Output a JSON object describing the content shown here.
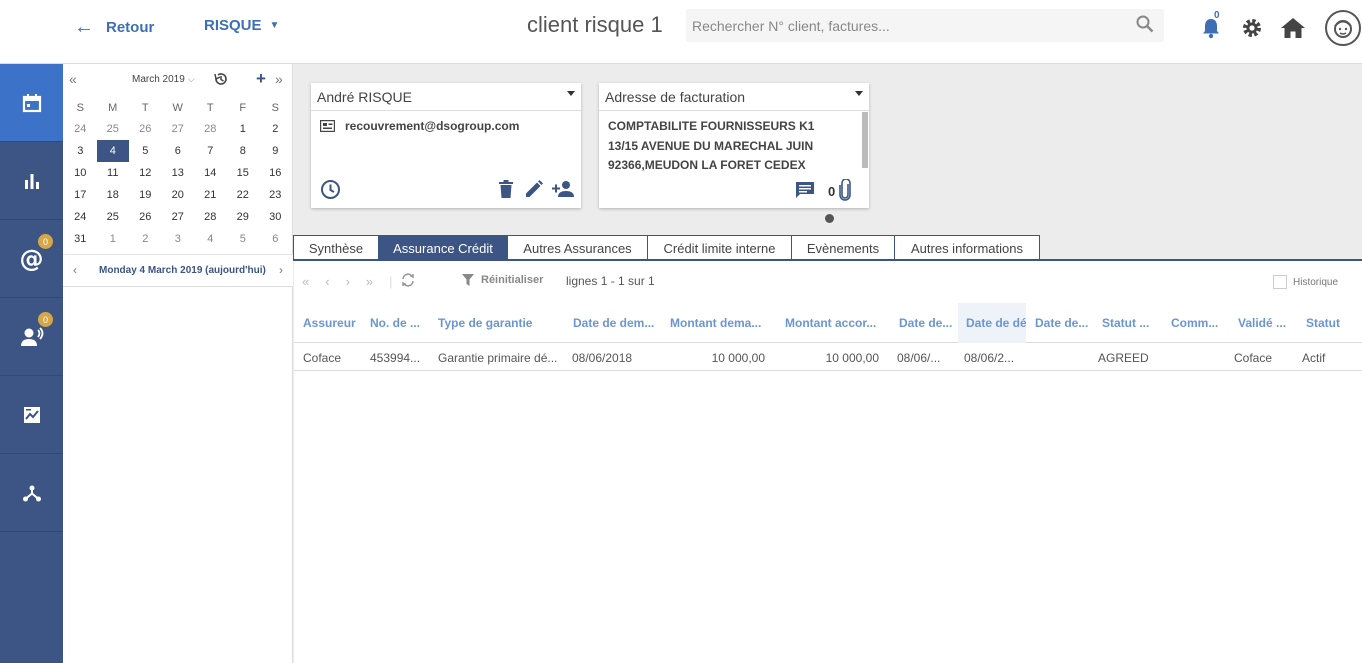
{
  "header": {
    "back_label": "Retour",
    "risk_label": "RISQUE",
    "title": "client risque 1",
    "search_placeholder": "Rechercher N° client, factures...",
    "notifications_count": "0"
  },
  "sidebar": {
    "items": [
      {
        "icon": "calendar-icon",
        "badge": ""
      },
      {
        "icon": "bar-chart-icon",
        "badge": ""
      },
      {
        "icon": "at-icon",
        "badge": "0"
      },
      {
        "icon": "contacts-icon",
        "badge": "0"
      },
      {
        "icon": "report-icon",
        "badge": ""
      },
      {
        "icon": "network-icon",
        "badge": ""
      }
    ]
  },
  "calendar": {
    "month_label": "March 2019",
    "weekdays": [
      "S",
      "M",
      "T",
      "W",
      "T",
      "F",
      "S"
    ],
    "weeks": [
      [
        "24",
        "25",
        "26",
        "27",
        "28",
        "1",
        "2"
      ],
      [
        "3",
        "4",
        "5",
        "6",
        "7",
        "8",
        "9"
      ],
      [
        "10",
        "11",
        "12",
        "13",
        "14",
        "15",
        "16"
      ],
      [
        "17",
        "18",
        "19",
        "20",
        "21",
        "22",
        "23"
      ],
      [
        "24",
        "25",
        "26",
        "27",
        "28",
        "29",
        "30"
      ],
      [
        "31",
        "1",
        "2",
        "3",
        "4",
        "5",
        "6"
      ]
    ],
    "today_label": "Monday 4 March 2019 (aujourd'hui)"
  },
  "contact_card": {
    "name": "André RISQUE",
    "email": "recouvrement@dsogroup.com"
  },
  "address_card": {
    "type": "Adresse de facturation",
    "line1": "COMPTABILITE FOURNISSEURS K1",
    "line2": "13/15 AVENUE DU MARECHAL JUIN",
    "line3": "92366,MEUDON LA FORET CEDEX",
    "attachments_count": "0"
  },
  "tabs": [
    {
      "label": "Synthèse",
      "width": 86
    },
    {
      "label": "Assurance Crédit",
      "width": 130,
      "active": true
    },
    {
      "label": "Autres Assurances",
      "width": 141
    },
    {
      "label": "Crédit limite interne",
      "width": 145
    },
    {
      "label": "Evènements",
      "width": 104
    },
    {
      "label": "Autres informations",
      "width": 146
    }
  ],
  "toolbar": {
    "reset_label": "Réinitialiser",
    "lines_label": "lignes 1 - 1 sur 1",
    "history_label": "Historique"
  },
  "grid": {
    "columns": [
      "Assureur",
      "No. de ...",
      "Type de garantie",
      "Date de dem...",
      "Montant dema...",
      "Montant accor...",
      "Date de...",
      "Date de dét",
      "Date de...",
      "Statut ...",
      "Comm...",
      "Validé ...",
      "Statut"
    ],
    "rows": [
      [
        "Coface",
        "453994...",
        "Garantie primaire dé...",
        "08/06/2018",
        "10 000,00",
        "10 000,00",
        "08/06/...",
        "08/06/2...",
        "",
        "AGREED",
        "",
        "Coface",
        "Actif"
      ]
    ]
  }
}
